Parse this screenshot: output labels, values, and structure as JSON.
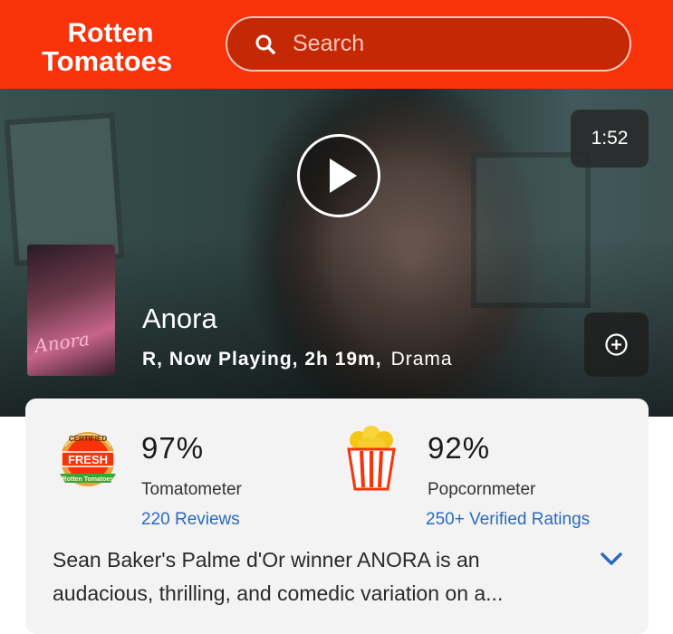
{
  "header": {
    "logo_line1": "Rotten",
    "logo_line2": "Tomatoes",
    "search_placeholder": "Search",
    "accent_color": "#fa320a"
  },
  "hero": {
    "duration": "1:52",
    "play_icon": "play-icon",
    "add_icon": "add-circle-icon"
  },
  "movie": {
    "title": "Anora",
    "meta": "R, Now Playing, 2h 19m,",
    "genre": "Drama",
    "poster_text": "Anora"
  },
  "scores": {
    "tomatometer": {
      "badge_text": "FRESH",
      "badge_top": "CERTIFIED",
      "badge_brand": "Rotten Tomatoes",
      "value": "97%",
      "label": "Tomatometer",
      "link": "220 Reviews"
    },
    "popcornmeter": {
      "value": "92%",
      "label": "Popcornmeter",
      "link": "250+ Verified Ratings"
    }
  },
  "synopsis": {
    "line1": "Sean Baker's Palme d'Or winner ANORA is an",
    "line2": "audacious, thrilling, and comedic variation on a..."
  }
}
